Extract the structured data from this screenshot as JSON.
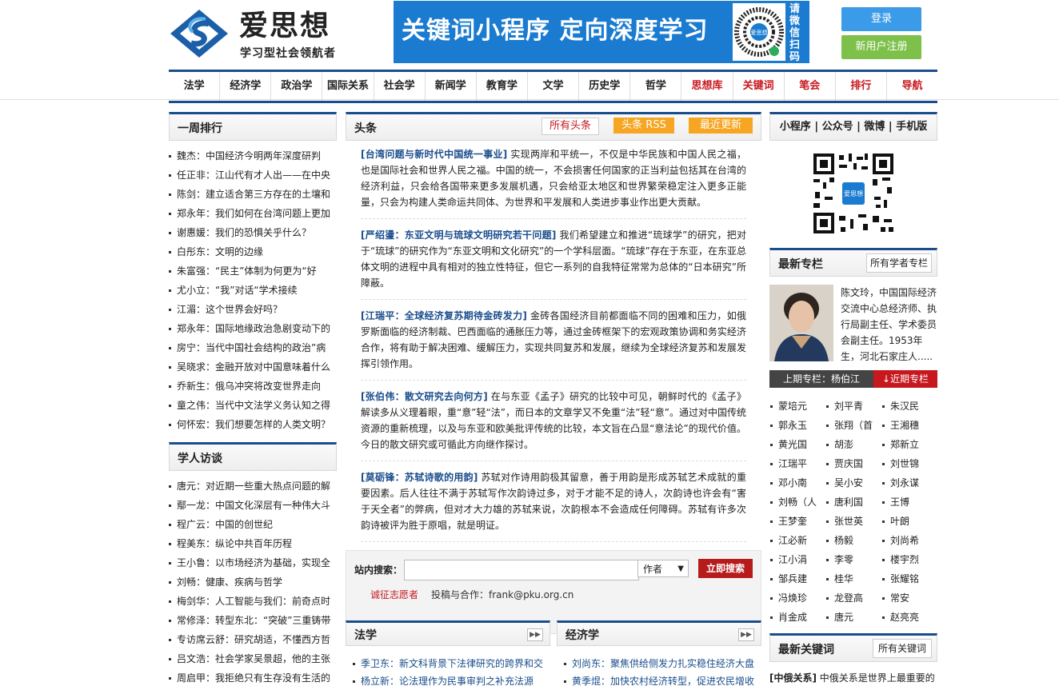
{
  "header": {
    "logo_name": "爱思想",
    "logo_slogan": "学习型社会领航者",
    "banner_text": "关键词小程序 定向深度学习",
    "banner_side": "请微信扫码",
    "qr_label": "爱思想",
    "login": "登录",
    "register": "新用户注册"
  },
  "nav": [
    "法学",
    "经济学",
    "政治学",
    "国际关系",
    "社会学",
    "新闻学",
    "教育学",
    "文学",
    "历史学",
    "哲学",
    "思想库",
    "关键词",
    "笔会",
    "排行",
    "导航"
  ],
  "weekly": {
    "title": "一周排行",
    "items": [
      "魏杰：中国经济今明两年深度研判",
      "任正非：江山代有才人出——在中央",
      "陈剑：建立适合第三方存在的土壤和",
      "郑永年：我们如何在台湾问题上更加",
      "谢惠媛：我们的恐惧关乎什么？",
      "白彤东：文明的边缘",
      "朱富强：“民主”体制为何更为“好",
      "尤小立：“我”对话“学术接续",
      "江湄：这个世界会好吗？",
      "郑永年：国际地缘政治急剧变动下的",
      "房宁：当代中国社会结构的政治”病",
      "吴晓求：金融开放对中国意味着什么",
      "乔新生：俄乌冲突将改变世界走向",
      "童之伟：当代中文法学义务认知之得",
      "何怀宏：我们想要怎样的人类文明？"
    ]
  },
  "interviews": {
    "title": "学人访谈",
    "items": [
      "唐元：对近期一些重大热点问题的解",
      "鄢一龙：中国文化深层有一种伟大斗",
      "程广云：中国的创世纪",
      "程美东：纵论中共百年历程",
      "王小鲁：以市场经济为基础，实现全",
      "刘畅：健康、疾病与哲学",
      "梅剑华：人工智能与我们：前奇点时",
      "常修泽：转型东北：“突破”三重铸带",
      "专访席云舒：研究胡适，不懂西方哲",
      "吕文浩：社会学家吴景超，他的主张",
      "周启甲：我拒绝只有生存没有生活的"
    ]
  },
  "headlines": {
    "title": "头条",
    "tag_all": "所有头条",
    "tag_rss": "头条 RSS",
    "tag_new": "最近更新",
    "items": [
      {
        "t": "[台湾问题与新时代中国统一事业]",
        "b": " 实现两岸和平统一，不仅是中华民族和中国人民之福，也是国际社会和世界人民之福。中国的统一，不会损害任何国家的正当利益包括其在台湾的经济利益，只会给各国带来更多发展机遇，只会给亚太地区和世界繁荣稳定注入更多正能量，只会为构建人类命运共同体、为世界和平发展和人类进步事业作出更大贡献。"
      },
      {
        "t": "[严绍璗：东亚文明与琉球文明研究若干问题]",
        "b": " 我们希望建立和推进“琉球学”的研究，把对于“琉球”的研究作为“东亚文明和文化研究”的一个学科层面。“琉球”存在于东亚，在东亚总体文明的进程中具有相对的独立性特征，但它一系列的自我特征常常为总体的“日本研究”所障蔽。"
      },
      {
        "t": "[江瑞平：全球经济复苏期待金砖发力]",
        "b": " 金砖各国经济目前都面临不同的困难和压力，如俄罗斯面临的经济制裁、巴西面临的通胀压力等，通过金砖框架下的宏观政策协调和务实经济合作，将有助于解决困难、缓解压力，实现共同复苏和发展，继续为全球经济复苏和发展发挥引领作用。"
      },
      {
        "t": "[张伯伟：散文研究去向何方]",
        "b": " 在与东亚《孟子》研究的比较中可见，朝鲜时代的《孟子》解读多从义理着眼，重“意”轻“法”，而日本的文章学又不免重“法”轻“意”。通过对中国传统资源的重新梳理，以及与东亚和欧美批评传统的比较，本文旨在凸显“意法论”的现代价值。今日的散文研究或可循此方向继作探讨。"
      },
      {
        "t": "[莫砺锋：苏轼诗歌的用韵]",
        "b": " 苏轼对作诗用韵极其留意，善于用韵是形成苏轼艺术成就的重要因素。后人往往不满于苏轼写作次韵诗过多，对于才能不足的诗人，次韵诗也许会有“害于天全者”的弊病，但对才大力雄的苏轼来说，次韵根本不会造成任何障碍。苏轼有许多次韵诗被评为胜于原唱，就是明证。"
      }
    ]
  },
  "search": {
    "label": "站内搜索：",
    "select": "作者",
    "button": "立即搜索",
    "volunteer": "诚征志愿者",
    "coop": "投稿与合作：frank@pku.org.cn"
  },
  "law": {
    "title": "法学",
    "items": [
      "季卫东：新文科背景下法律研究的跨界和交",
      "杨立新：论法理作为民事审判之补充法源"
    ]
  },
  "econ": {
    "title": "经济学",
    "items": [
      "刘尚东：聚焦供给侧发力扎实稳住经济大盘",
      "黄季焜：加快农村经济转型，促进农民增收"
    ]
  },
  "right": {
    "tabs": "小程序 | 公众号 | 微博 | 手机版",
    "zl_title": "最新专栏",
    "zl_btn": "所有学者专栏",
    "bio": "陈文玲，中国国际经济交流中心总经济师、执行局副主任、学术委员会副主任。1953年生，河北石家庄人.....",
    "prev": "上期专栏：杨伯江",
    "next": "↓近期专栏",
    "authors": [
      "蒙培元",
      "刘平青",
      "朱汉民",
      "郭永玉",
      "张翔（首",
      "王湘穗",
      "黄光国",
      "胡澎",
      "郑新立",
      "江瑞平",
      "贾庆国",
      "刘世锦",
      "邓小南",
      "吴小安",
      "刘永谋",
      "刘畅（人",
      "唐利国",
      "王博",
      "王梦奎",
      "张世英",
      "叶朗",
      "江必新",
      "杨毅",
      "刘尚希",
      "江小涓",
      "李零",
      "楼宇烈",
      "邹兵建",
      "桂华",
      "张耀铭",
      "冯焕珍",
      "龙登高",
      "常安",
      "肖金成",
      "唐元",
      "赵亮亮"
    ],
    "gj_title": "最新关键词",
    "gj_btn": "所有关键词",
    "gj_key": "[中俄关系]",
    "gj_text": " 中俄关系是世界上最重要的"
  },
  "colors": {
    "nav_border": "#1a4d8c",
    "accent_red": "#c7181f",
    "banner_blue": "#1a7bd0",
    "login_blue": "#3b9be8",
    "register_green": "#7dc04a",
    "tag_orange": "#f6a623"
  }
}
